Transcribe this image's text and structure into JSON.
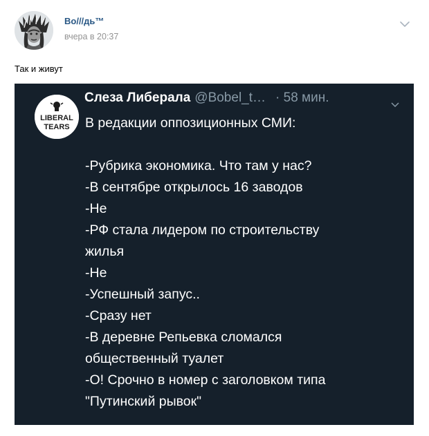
{
  "post": {
    "author": "Во///дь™",
    "date": "вчера в 20:37",
    "text": "Так и живут",
    "menu_icon": "chevron-down-icon"
  },
  "tweet": {
    "name": "Слеза Либерала",
    "handle": "@Bobel_t…",
    "time": "· 58 мин.",
    "logo_lines": [
      "LIBERAL",
      "TEARS"
    ],
    "lines": [
      "В редакции оппозиционных СМИ:",
      "",
      "-Рубрика экономика. Что там у нас?",
      "-В сентябре открылось 16 заводов",
      "-Не",
      "-РФ стала лидером по строительству",
      "жилья",
      "-Не",
      "-Успешный запус..",
      "-Сразу нет",
      "-В деревне Репьевка сломался",
      "общественный туалет",
      "-О! Срочно в номер с заголовком типа",
      "\"Путинский рывок\""
    ],
    "colors": {
      "background": "#15202b",
      "text": "#ffffff",
      "muted": "#8899a6"
    }
  }
}
